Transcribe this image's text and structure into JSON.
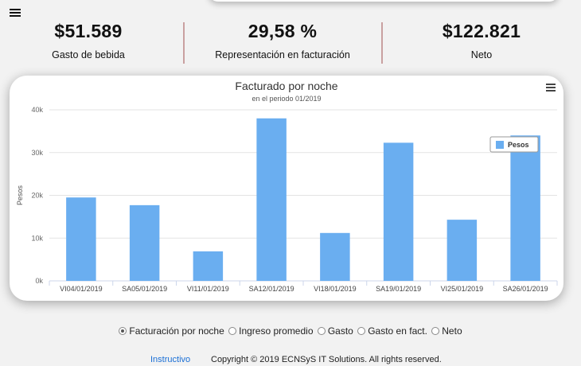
{
  "menu": {
    "icon": "hamburger-icon"
  },
  "kpis": [
    {
      "value": "$51.589",
      "label": "Gasto de bebida"
    },
    {
      "value": "29,58 %",
      "label": "Representación en facturación"
    },
    {
      "value": "$122.821",
      "label": "Neto"
    }
  ],
  "chart": {
    "menu_icon": "hamburger-icon"
  },
  "chart_data": {
    "type": "bar",
    "title": "Facturado por noche",
    "subtitle": "en el periodo 01/2019",
    "xlabel": "",
    "ylabel": "Pesos",
    "categories": [
      "VI04/01/2019",
      "SA05/01/2019",
      "VI11/01/2019",
      "SA12/01/2019",
      "VI18/01/2019",
      "SA19/01/2019",
      "VI25/01/2019",
      "SA26/01/2019"
    ],
    "series": [
      {
        "name": "Pesos",
        "values": [
          19500,
          17700,
          6900,
          38000,
          11200,
          32300,
          14300,
          34000
        ],
        "color": "#6aaef0"
      }
    ],
    "ylim": [
      0,
      40000
    ],
    "yticks": [
      0,
      10000,
      20000,
      30000,
      40000
    ],
    "ytick_labels": [
      "0k",
      "10k",
      "20k",
      "30k",
      "40k"
    ],
    "grid": true,
    "legend_position": "top-right"
  },
  "options": [
    {
      "label": "Facturación por noche",
      "selected": true
    },
    {
      "label": "Ingreso promedio",
      "selected": false
    },
    {
      "label": "Gasto",
      "selected": false
    },
    {
      "label": "Gasto en fact.",
      "selected": false
    },
    {
      "label": "Neto",
      "selected": false
    }
  ],
  "footer": {
    "link": "Instructivo",
    "copyright": "Copyright © 2019 ECNSyS IT Solutions. All rights reserved."
  }
}
